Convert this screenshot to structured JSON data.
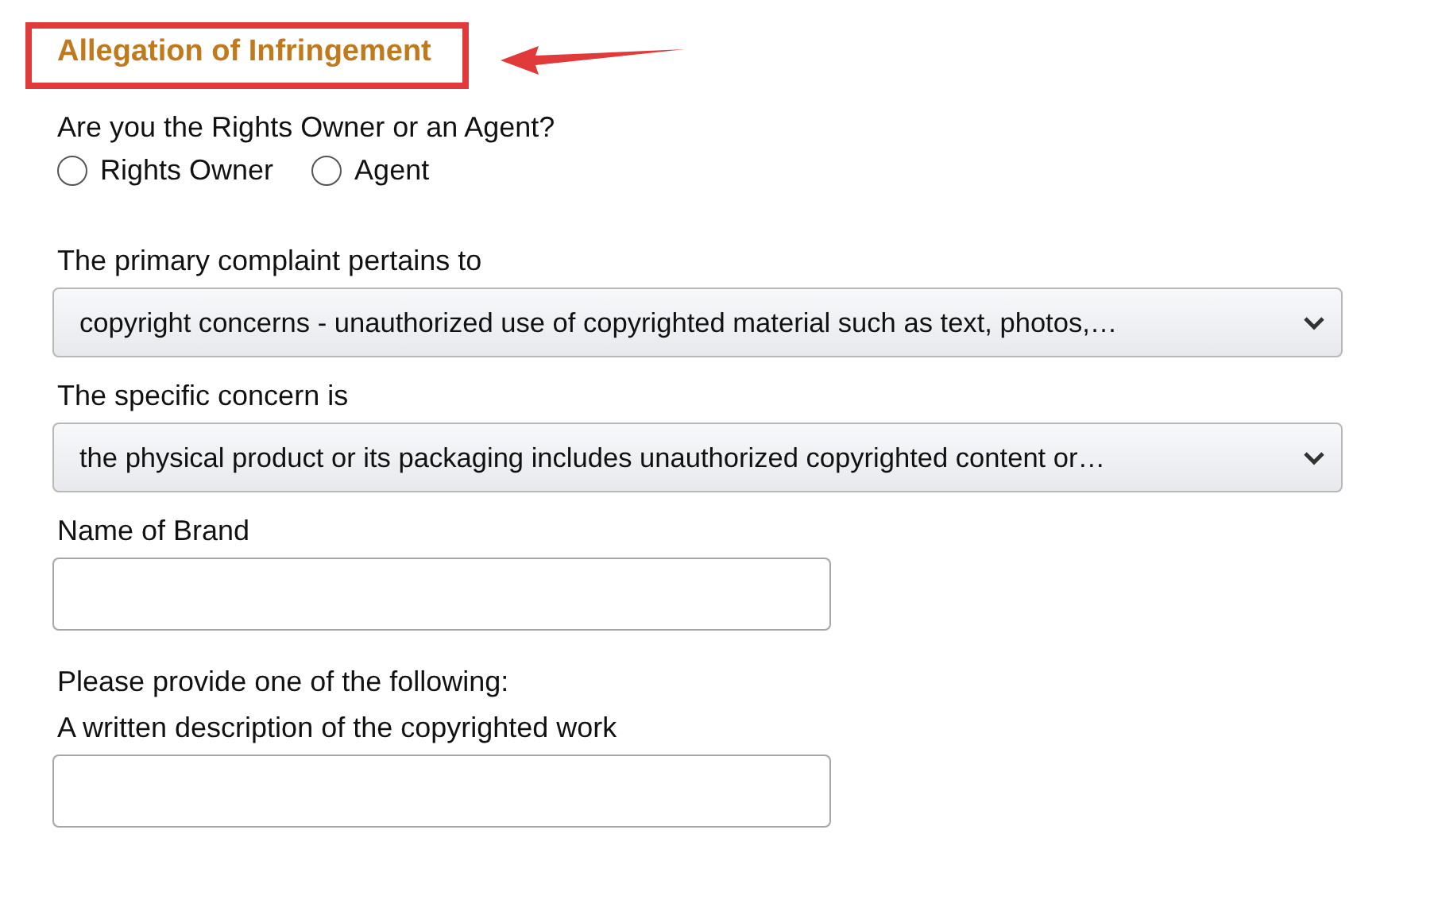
{
  "heading": {
    "text": "Allegation of Infringement",
    "highlighted": true
  },
  "role_question": {
    "label": "Are you the Rights Owner or an Agent?",
    "options": [
      {
        "label": "Rights Owner",
        "selected": false
      },
      {
        "label": "Agent",
        "selected": false
      }
    ]
  },
  "fields": [
    {
      "kind": "select",
      "label": "The primary complaint pertains to",
      "value": "copyright concerns - unauthorized use of copyrighted material such as text, photos,…"
    },
    {
      "kind": "select",
      "label": "The specific concern is",
      "value": "the physical product or its packaging includes unauthorized copyrighted content or…"
    },
    {
      "kind": "input",
      "label": "Name of Brand"
    },
    {
      "kind": "note",
      "label": "Please provide one of the following:"
    },
    {
      "kind": "input",
      "label": "A written description of the copyrighted work"
    }
  ]
}
